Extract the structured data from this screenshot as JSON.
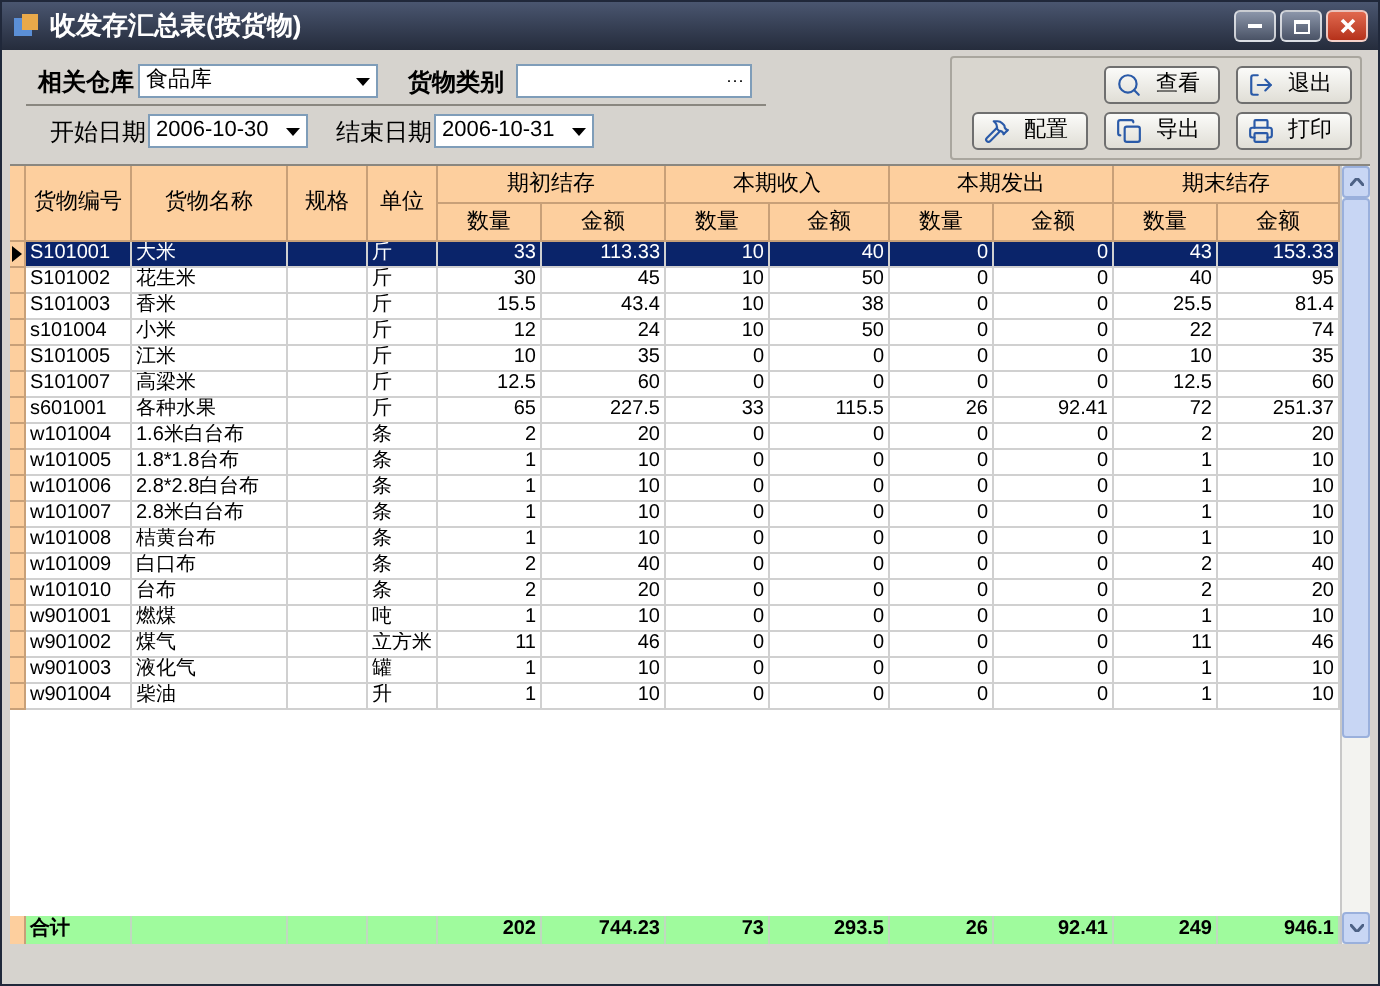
{
  "window": {
    "title": "收发存汇总表(按货物)"
  },
  "filters": {
    "warehouse": {
      "label": "相关仓库",
      "value": "食品库"
    },
    "category": {
      "label": "货物类别",
      "button": "···"
    },
    "start_date": {
      "label": "开始日期",
      "value": "2006-10-30"
    },
    "end_date": {
      "label": "结束日期",
      "value": "2006-10-31"
    }
  },
  "buttons": [
    {
      "label": "查看",
      "kind": "search"
    },
    {
      "label": "退出",
      "kind": "exit"
    },
    {
      "label": "配置",
      "kind": "config"
    },
    {
      "label": "导出",
      "kind": "export"
    },
    {
      "label": "打印",
      "kind": "print"
    }
  ],
  "table": {
    "columns": [
      "货物编号",
      "货物名称",
      "规格",
      "单位"
    ],
    "groups": [
      {
        "label": "期初结存",
        "sub": [
          "数量",
          "金额"
        ]
      },
      {
        "label": "本期收入",
        "sub": [
          "数量",
          "金额"
        ]
      },
      {
        "label": "本期发出",
        "sub": [
          "数量",
          "金额"
        ]
      },
      {
        "label": "期末结存",
        "sub": [
          "数量",
          "金额"
        ]
      }
    ],
    "rows": [
      {
        "selected": true,
        "cells": [
          "S101001",
          "大米",
          "",
          "斤",
          "33",
          "113.33",
          "10",
          "40",
          "0",
          "0",
          "43",
          "153.33"
        ]
      },
      {
        "selected": false,
        "cells": [
          "S101002",
          "花生米",
          "",
          "斤",
          "30",
          "45",
          "10",
          "50",
          "0",
          "0",
          "40",
          "95"
        ]
      },
      {
        "selected": false,
        "cells": [
          "S101003",
          "香米",
          "",
          "斤",
          "15.5",
          "43.4",
          "10",
          "38",
          "0",
          "0",
          "25.5",
          "81.4"
        ]
      },
      {
        "selected": false,
        "cells": [
          "s101004",
          "小米",
          "",
          "斤",
          "12",
          "24",
          "10",
          "50",
          "0",
          "0",
          "22",
          "74"
        ]
      },
      {
        "selected": false,
        "cells": [
          "S101005",
          "江米",
          "",
          "斤",
          "10",
          "35",
          "0",
          "0",
          "0",
          "0",
          "10",
          "35"
        ]
      },
      {
        "selected": false,
        "cells": [
          "S101007",
          "高梁米",
          "",
          "斤",
          "12.5",
          "60",
          "0",
          "0",
          "0",
          "0",
          "12.5",
          "60"
        ]
      },
      {
        "selected": false,
        "cells": [
          "s601001",
          "各种水果",
          "",
          "斤",
          "65",
          "227.5",
          "33",
          "115.5",
          "26",
          "92.41",
          "72",
          "251.37"
        ]
      },
      {
        "selected": false,
        "cells": [
          "w101004",
          "1.6米白台布",
          "",
          "条",
          "2",
          "20",
          "0",
          "0",
          "0",
          "0",
          "2",
          "20"
        ]
      },
      {
        "selected": false,
        "cells": [
          "w101005",
          "1.8*1.8台布",
          "",
          "条",
          "1",
          "10",
          "0",
          "0",
          "0",
          "0",
          "1",
          "10"
        ]
      },
      {
        "selected": false,
        "cells": [
          "w101006",
          "2.8*2.8白台布",
          "",
          "条",
          "1",
          "10",
          "0",
          "0",
          "0",
          "0",
          "1",
          "10"
        ]
      },
      {
        "selected": false,
        "cells": [
          "w101007",
          "2.8米白台布",
          "",
          "条",
          "1",
          "10",
          "0",
          "0",
          "0",
          "0",
          "1",
          "10"
        ]
      },
      {
        "selected": false,
        "cells": [
          "w101008",
          "桔黄台布",
          "",
          "条",
          "1",
          "10",
          "0",
          "0",
          "0",
          "0",
          "1",
          "10"
        ]
      },
      {
        "selected": false,
        "cells": [
          "w101009",
          "白口布",
          "",
          "条",
          "2",
          "40",
          "0",
          "0",
          "0",
          "0",
          "2",
          "40"
        ]
      },
      {
        "selected": false,
        "cells": [
          "w101010",
          "台布",
          "",
          "条",
          "2",
          "20",
          "0",
          "0",
          "0",
          "0",
          "2",
          "20"
        ]
      },
      {
        "selected": false,
        "cells": [
          "w901001",
          "燃煤",
          "",
          "吨",
          "1",
          "10",
          "0",
          "0",
          "0",
          "0",
          "1",
          "10"
        ]
      },
      {
        "selected": false,
        "cells": [
          "w901002",
          "煤气",
          "",
          "立方米",
          "11",
          "46",
          "0",
          "0",
          "0",
          "0",
          "11",
          "46"
        ]
      },
      {
        "selected": false,
        "cells": [
          "w901003",
          "液化气",
          "",
          "罐",
          "1",
          "10",
          "0",
          "0",
          "0",
          "0",
          "1",
          "10"
        ]
      },
      {
        "selected": false,
        "cells": [
          "w901004",
          "柴油",
          "",
          "升",
          "1",
          "10",
          "0",
          "0",
          "0",
          "0",
          "1",
          "10"
        ]
      }
    ],
    "total": {
      "label": "合计",
      "values": [
        "202",
        "744.23",
        "73",
        "293.5",
        "26",
        "92.41",
        "249",
        "946.1"
      ]
    }
  }
}
